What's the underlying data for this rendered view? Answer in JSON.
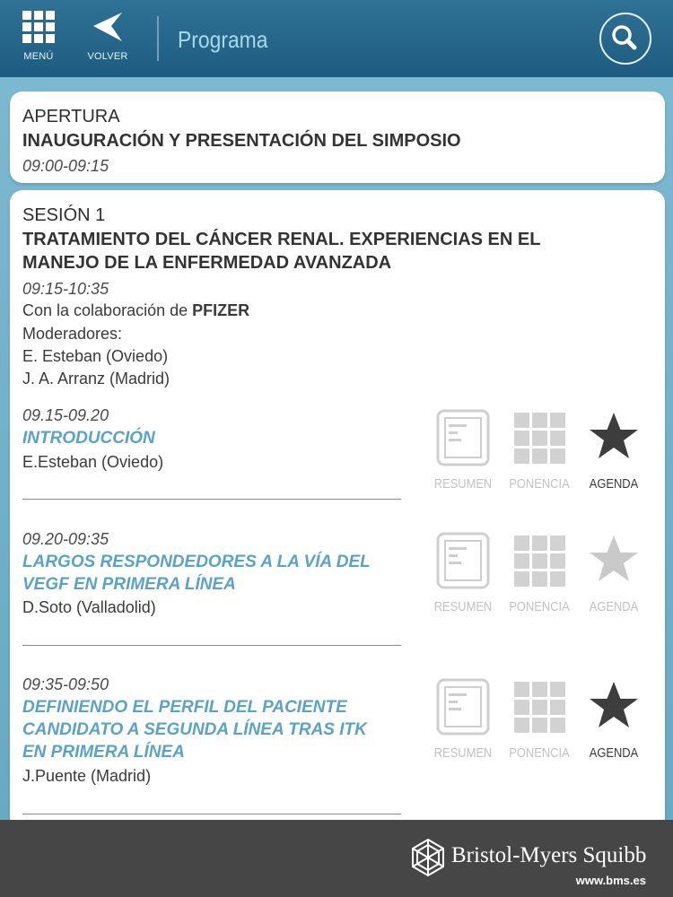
{
  "header": {
    "menu_label": "MENÚ",
    "back_label": "VOLVER",
    "title": "Programa"
  },
  "opening": {
    "label": "APERTURA",
    "title": "INAUGURACIÓN Y PRESENTACIÓN DEL SIMPOSIO",
    "time": "09:00-09:15"
  },
  "session": {
    "label": "SESIÓN 1",
    "title_line1": "TRATAMIENTO DEL CÁNCER RENAL. EXPERIENCIAS EN EL",
    "title_line2": "MANEJO DE LA ENFERMEDAD AVANZADA",
    "time": "09:15-10:35",
    "collab_prefix": "Con la colaboración de ",
    "collab_sponsor": "PFIZER",
    "moderators_label": "Moderadores:",
    "moderators": [
      "E. Esteban (Oviedo)",
      "J. A. Arranz (Madrid)"
    ]
  },
  "talks": [
    {
      "time": "09.15-09.20",
      "title_lines": [
        "INTRODUCCIÓN"
      ],
      "speaker": "E.Esteban (Oviedo)",
      "agenda_selected": true
    },
    {
      "time": "09.20-09:35",
      "title_lines": [
        "LARGOS RESPONDEDORES A LA VÍA DEL",
        "VEGF EN PRIMERA LÍNEA"
      ],
      "speaker": "D.Soto (Valladolid)",
      "agenda_selected": false
    },
    {
      "time": "09:35-09:50",
      "title_lines": [
        "DEFINIENDO EL PERFIL DEL PACIENTE",
        "CANDIDATO A SEGUNDA LÍNEA TRAS ITK",
        "EN PRIMERA LÍNEA"
      ],
      "speaker": "J.Puente (Madrid)",
      "agenda_selected": true
    }
  ],
  "actions": {
    "resumen": "RESUMEN",
    "ponencia": "PONENCIA",
    "agenda": "AGENDA"
  },
  "icons": {
    "menu": "grid-icon",
    "back": "back-arrow-icon",
    "search": "search-icon",
    "resumen": "document-icon",
    "ponencia": "slides-grid-icon",
    "agenda": "star-icon"
  },
  "colors": {
    "header_bg": "#1d5c80",
    "title": "#a9d8ea",
    "talk_title": "#5aa2c7",
    "star_on": "#3d3d3d",
    "star_off": "#c9c9c9"
  },
  "footer": {
    "brand": "Bristol-Myers Squibb",
    "url": "www.bms.es"
  }
}
